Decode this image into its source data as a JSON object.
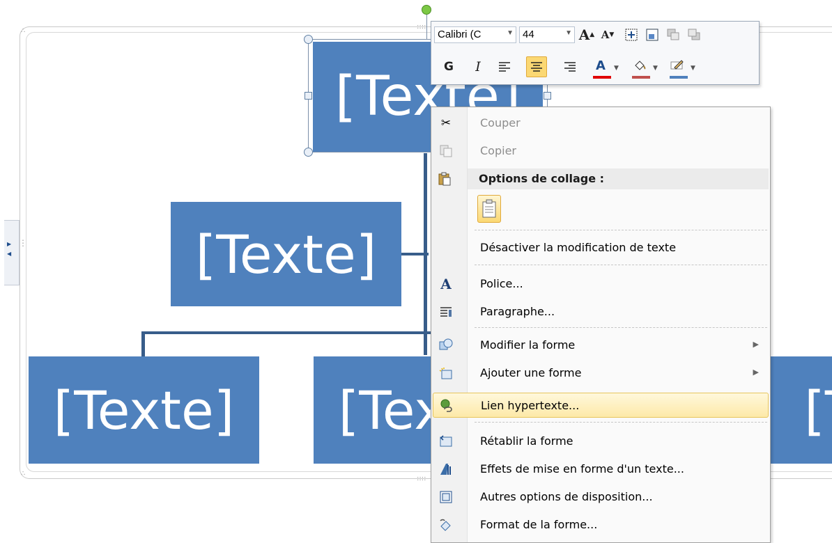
{
  "smartart": {
    "boxes": {
      "top": "[Texte]",
      "assistant": "[Texte]",
      "bottom_left": "[Texte]",
      "bottom_middle": "[Texte]",
      "bottom_right": "[Texte]"
    }
  },
  "mini_toolbar": {
    "font_name": "Calibri (C",
    "font_size": "44",
    "bold_label": "G",
    "italic_label": "I",
    "active_button": "align-center"
  },
  "context_menu": {
    "items": [
      {
        "label": "Couper",
        "icon": "scissors-icon",
        "enabled": false
      },
      {
        "label": "Copier",
        "icon": "copy-icon",
        "enabled": false
      },
      {
        "label": "Options de collage :",
        "icon": "paste-icon",
        "header": true
      },
      {
        "label": "Désactiver la modification de texte"
      },
      {
        "label": "Police...",
        "icon": "font-icon"
      },
      {
        "label": "Paragraphe...",
        "icon": "paragraph-icon"
      },
      {
        "label": "Modifier la forme",
        "icon": "change-shape-icon",
        "submenu": true
      },
      {
        "label": "Ajouter une forme",
        "icon": "add-shape-icon",
        "submenu": true
      },
      {
        "label": "Lien hypertexte...",
        "icon": "hyperlink-icon",
        "highlighted": true
      },
      {
        "label": "Rétablir la forme",
        "icon": "reset-shape-icon"
      },
      {
        "label": "Effets de mise en forme d'un texte...",
        "icon": "text-effects-icon"
      },
      {
        "label": "Autres options de disposition...",
        "icon": "layout-options-icon"
      },
      {
        "label": "Format de la forme...",
        "icon": "format-shape-icon"
      }
    ]
  },
  "colors": {
    "box_fill": "#4f81bd",
    "connector": "#385d8a",
    "highlight": "#fde9a8",
    "font_color_red": "#e00000"
  }
}
